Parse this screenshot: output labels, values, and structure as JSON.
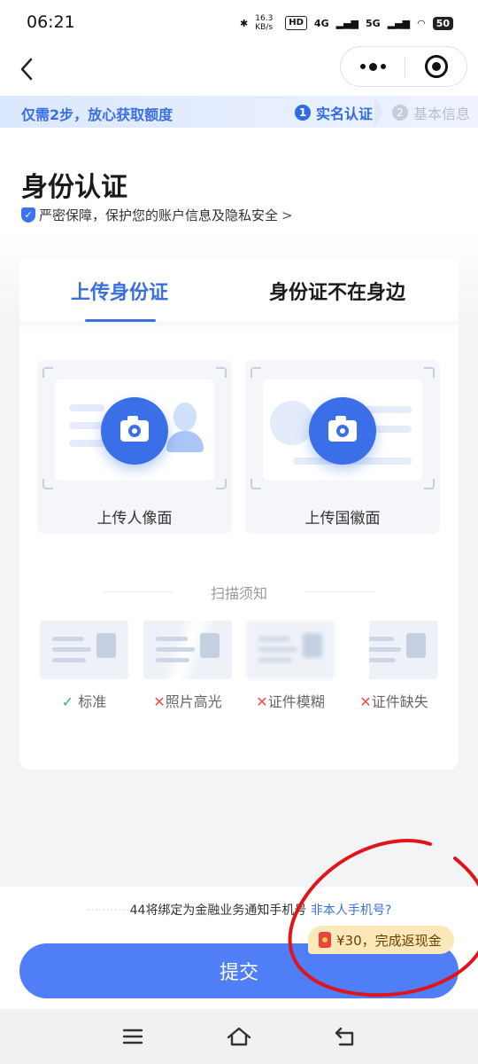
{
  "status_bar": {
    "time": "06:21",
    "net_speed": "16.3 KB/s",
    "hd_label": "HD",
    "network_4g": "4G",
    "network_5g": "5G",
    "battery": "50"
  },
  "header": {
    "back_icon": "chevron-left-icon",
    "more_icon": "more-dots-icon",
    "close_icon": "target-close-icon"
  },
  "steps": {
    "hint": "仅需2步，放心获取额度",
    "step1_num": "1",
    "step1_label": "实名认证",
    "step2_num": "2",
    "step2_label": "基本信息",
    "active_color": "#2f6be6"
  },
  "page": {
    "title": "身份认证",
    "security_text": "严密保障，保护您的账户信息及隐私安全",
    "security_arrow": ">"
  },
  "tabs": [
    {
      "label": "上传身份证",
      "active": true
    },
    {
      "label": "身份证不在身边",
      "active": false
    }
  ],
  "upload": {
    "front_label": "上传人像面",
    "back_label": "上传国徽面",
    "camera_icon": "camera-icon"
  },
  "scan": {
    "title": "扫描须知",
    "samples": [
      {
        "mark": "✓",
        "label": "标准",
        "status": "ok"
      },
      {
        "mark": "✕",
        "label": "照片高光",
        "status": "bad"
      },
      {
        "mark": "✕",
        "label": "证件模糊",
        "status": "bad"
      },
      {
        "mark": "✕",
        "label": "证件缺失",
        "status": "bad"
      }
    ]
  },
  "bottom": {
    "phone_masked": "···········",
    "phone_tail": "44",
    "notice_text": "将绑定为金融业务通知手机号",
    "notice_link": "非本人手机号?",
    "reward_text": "¥30，完成返现金",
    "submit_label": "提交",
    "primary_color": "#4f7ef7"
  },
  "system_nav": {
    "menu_icon": "menu-icon",
    "home_icon": "home-icon",
    "back_icon": "return-icon"
  }
}
